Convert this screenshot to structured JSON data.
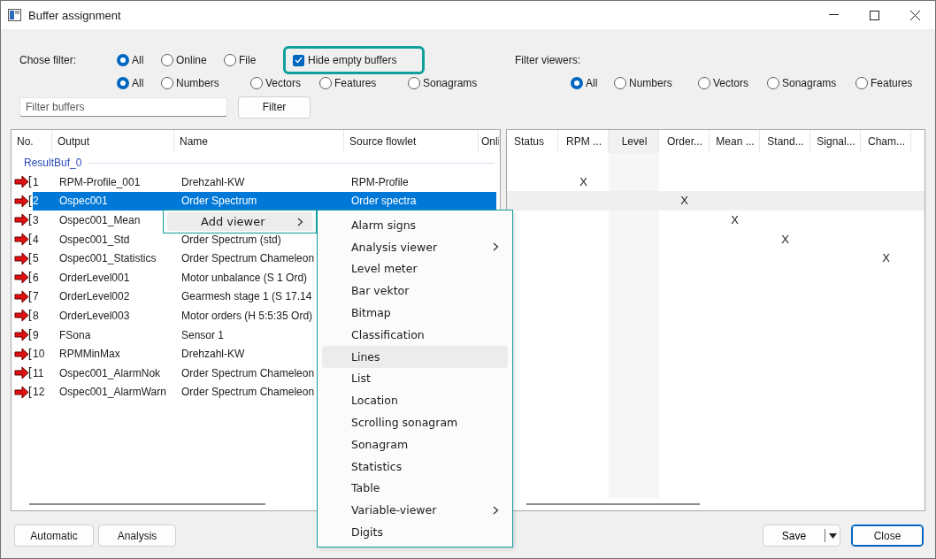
{
  "window": {
    "title": "Buffer assignment"
  },
  "buffer_filter": {
    "label": "Chose filter:",
    "source_options": [
      {
        "label": "All",
        "selected": true
      },
      {
        "label": "Online",
        "selected": false
      },
      {
        "label": "File",
        "selected": false
      }
    ],
    "hide_empty": {
      "label": "Hide empty buffers",
      "checked": true,
      "highlighted": true
    },
    "type_options": [
      {
        "label": "All",
        "selected": true
      },
      {
        "label": "Numbers",
        "selected": false
      },
      {
        "label": "Vectors",
        "selected": false
      },
      {
        "label": "Features",
        "selected": false
      },
      {
        "label": "Sonagrams",
        "selected": false
      }
    ],
    "search": {
      "placeholder": "Filter buffers"
    },
    "button": "Filter"
  },
  "viewer_filter": {
    "label": "Filter viewers:",
    "options": [
      {
        "label": "All",
        "selected": true
      },
      {
        "label": "Numbers",
        "selected": false
      },
      {
        "label": "Vectors",
        "selected": false
      },
      {
        "label": "Sonagrams",
        "selected": false
      },
      {
        "label": "Features",
        "selected": false
      }
    ]
  },
  "buffer_table": {
    "columns": [
      "No.",
      "Output",
      "Name",
      "Source flowlet",
      "Onli"
    ],
    "group": "ResultBuf_0",
    "rows": [
      {
        "no": "1",
        "output": "RPM-Profile_001",
        "name": "Drehzahl-KW",
        "source": "RPM-Profile",
        "selected": false
      },
      {
        "no": "2",
        "output": "Ospec001",
        "name": "Order Spectrum",
        "source": "Order spectra",
        "selected": true
      },
      {
        "no": "3",
        "output": "Ospec001_Mean",
        "selected": false
      },
      {
        "no": "4",
        "output": "Ospec001_Std",
        "name": "Order Spectrum (std)",
        "selected": false
      },
      {
        "no": "5",
        "output": "Ospec001_Statistics",
        "name": "Order Spectrum Chameleon",
        "selected": false
      },
      {
        "no": "6",
        "output": "OrderLevel001",
        "name": "Motor unbalance (S 1 Ord)",
        "selected": false
      },
      {
        "no": "7",
        "output": "OrderLevel002",
        "name": "Gearmesh stage 1 (S 17.14",
        "selected": false
      },
      {
        "no": "8",
        "output": "OrderLevel003",
        "name": "Motor orders (H 5:5:35 Ord)",
        "selected": false
      },
      {
        "no": "9",
        "output": "FSona",
        "name": "Sensor 1",
        "selected": false
      },
      {
        "no": "10",
        "output": "RPMMinMax",
        "name": "Drehzahl-KW",
        "selected": false
      },
      {
        "no": "11",
        "output": "Ospec001_AlarmNok",
        "name": "Order Spectrum Chameleon",
        "selected": false
      },
      {
        "no": "12",
        "output": "Ospec001_AlarmWarn",
        "name": "Order Spectrum Chameleon",
        "selected": false
      }
    ]
  },
  "viewer_table": {
    "columns": [
      {
        "label": "Status",
        "shaded": false
      },
      {
        "label": "RPM ...",
        "shaded": false
      },
      {
        "label": "Level",
        "shaded": true
      },
      {
        "label": "Order...",
        "shaded": false
      },
      {
        "label": "Mean ...",
        "shaded": false
      },
      {
        "label": "Stand...",
        "shaded": false
      },
      {
        "label": "Signal...",
        "shaded": false
      },
      {
        "label": "Cham...",
        "shaded": false
      }
    ],
    "rows": [
      {
        "selected": false,
        "cells": [
          null,
          "X",
          null,
          null,
          null,
          null,
          null,
          null
        ]
      },
      {
        "selected": true,
        "cells": [
          null,
          null,
          null,
          "X",
          null,
          null,
          null,
          null
        ]
      },
      {
        "selected": false,
        "cells": [
          null,
          null,
          null,
          null,
          "X",
          null,
          null,
          null
        ]
      },
      {
        "selected": false,
        "cells": [
          null,
          null,
          null,
          null,
          null,
          "X",
          null,
          null
        ]
      },
      {
        "selected": false,
        "cells": [
          null,
          null,
          null,
          null,
          null,
          null,
          null,
          "X"
        ]
      }
    ]
  },
  "context_menu": {
    "item": {
      "label": "Add viewer",
      "has_submenu": true
    },
    "submenu": [
      {
        "label": "Alarm signs",
        "has_submenu": false,
        "hovered": false
      },
      {
        "label": "Analysis viewer",
        "has_submenu": true,
        "hovered": false
      },
      {
        "label": "Level meter",
        "has_submenu": false,
        "hovered": false
      },
      {
        "label": "Bar vektor",
        "has_submenu": false,
        "hovered": false
      },
      {
        "label": "Bitmap",
        "has_submenu": false,
        "hovered": false
      },
      {
        "label": "Classification",
        "has_submenu": false,
        "hovered": false
      },
      {
        "label": "Lines",
        "has_submenu": false,
        "hovered": true
      },
      {
        "label": "List",
        "has_submenu": false,
        "hovered": false
      },
      {
        "label": "Location",
        "has_submenu": false,
        "hovered": false
      },
      {
        "label": "Scrolling sonagram",
        "has_submenu": false,
        "hovered": false
      },
      {
        "label": "Sonagram",
        "has_submenu": false,
        "hovered": false
      },
      {
        "label": "Statistics",
        "has_submenu": false,
        "hovered": false
      },
      {
        "label": "Table",
        "has_submenu": false,
        "hovered": false
      },
      {
        "label": "Variable-viewer",
        "has_submenu": true,
        "hovered": false
      },
      {
        "label": "Digits",
        "has_submenu": false,
        "hovered": false
      }
    ]
  },
  "buttons": [
    {
      "label": "Automatic",
      "kind": "plain"
    },
    {
      "label": "Analysis",
      "kind": "plain"
    },
    {
      "label": "Save",
      "kind": "split"
    },
    {
      "label": "Close",
      "kind": "default"
    }
  ]
}
